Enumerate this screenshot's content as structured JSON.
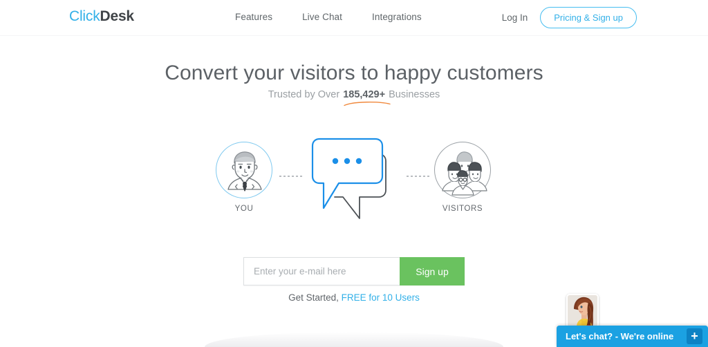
{
  "brand": {
    "logo_primary": "Click",
    "logo_secondary": "Desk",
    "accent_blue": "#32b0e8",
    "accent_green": "#6ac25f",
    "accent_orange": "#f0883c",
    "chat_blue": "#1ba1e2"
  },
  "nav": {
    "items": [
      {
        "label": "Features"
      },
      {
        "label": "Live Chat"
      },
      {
        "label": "Integrations"
      }
    ],
    "login_label": "Log In",
    "cta_label": "Pricing & Sign up"
  },
  "hero": {
    "title": "Convert your visitors to happy customers",
    "subtitle_prefix": "Trusted by Over ",
    "subtitle_count": "185,429+",
    "subtitle_suffix": " Businesses"
  },
  "illustration": {
    "you_label": "YOU",
    "visitors_label": "VISITORS",
    "you_icon": "person-avatar-icon",
    "visitors_icon": "group-avatar-icon",
    "bubble_icon": "chat-bubbles-icon",
    "typing_dots": 3
  },
  "signup": {
    "email_placeholder": "Enter your e-mail here",
    "email_value": "",
    "button_label": "Sign up",
    "get_started_text": "Get Started,",
    "free_link_label": "FREE for 10 Users"
  },
  "chat_widget": {
    "message": "Let's chat? - We're online",
    "expand_icon": "plus-icon",
    "avatar_icon": "agent-photo-avatar"
  }
}
